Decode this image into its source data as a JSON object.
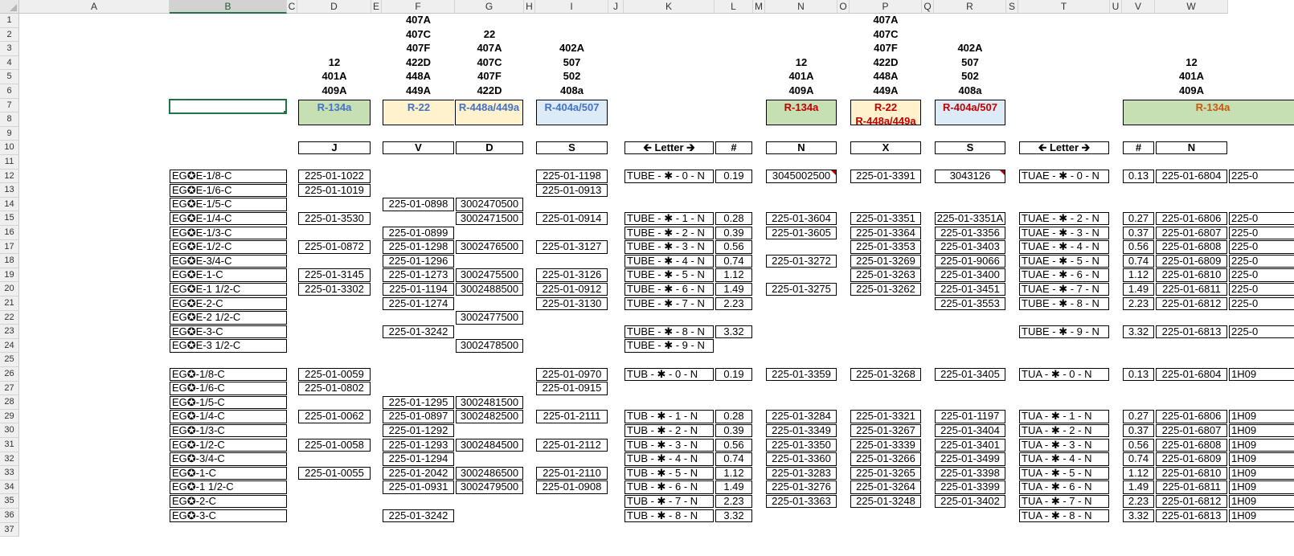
{
  "columns": [
    "A",
    "B",
    "C",
    "D",
    "E",
    "F",
    "G",
    "H",
    "I",
    "J",
    "K",
    "L",
    "M",
    "N",
    "O",
    "P",
    "Q",
    "R",
    "S",
    "T",
    "U",
    "V",
    "W"
  ],
  "rows": [
    "1",
    "2",
    "3",
    "4",
    "5",
    "6",
    "7",
    "8",
    "9",
    "10",
    "11",
    "12",
    "13",
    "14",
    "15",
    "16",
    "17",
    "18",
    "19",
    "20",
    "21",
    "22",
    "23",
    "24",
    "25",
    "26",
    "27",
    "28",
    "29",
    "30",
    "31",
    "32",
    "33",
    "34",
    "35",
    "36",
    "37"
  ],
  "selected_column": "B",
  "head": {
    "D": [
      "12",
      "401A",
      "409A"
    ],
    "F": [
      "407A",
      "407C",
      "407F",
      "422D",
      "448A",
      "449A"
    ],
    "G": [
      "22",
      "407A",
      "407C",
      "407F",
      "422D"
    ],
    "I": [
      "402A",
      "507",
      "502",
      "408a"
    ],
    "N": [
      "12",
      "401A",
      "409A"
    ],
    "P": [
      "407A",
      "407C",
      "407F",
      "422D",
      "448A",
      "449A"
    ],
    "R": [
      "402A",
      "507",
      "502",
      "408a"
    ],
    "W": [
      "12",
      "401A",
      "409A"
    ]
  },
  "refrigerants": {
    "D": "R-134a",
    "F": "R-22",
    "G": "R-448a/449a",
    "I": "R-404a/507",
    "N": "R-134a",
    "P1": "R-22",
    "P2": "R-448a/449a",
    "R": "R-404a/507",
    "VW": "R-134a"
  },
  "keys": {
    "D": "J",
    "F": "V",
    "G": "D",
    "I": "S",
    "K": "🡰 Letter 🡲",
    "L": "#",
    "N": "N",
    "P": "X",
    "R": "S",
    "T": "🡰 Letter 🡲",
    "V": "#",
    "W": "N"
  },
  "colors": {
    "green": "#c6e0b4",
    "yellow": "#fff2cc",
    "blue": "#ddebf7",
    "blue_text": "#4472c4",
    "red_text": "#c00000",
    "orange_text": "#c65911",
    "excel_green": "#217346"
  },
  "B": {
    "12": "EG✪E-1/8-C",
    "13": "EG✪E-1/6-C",
    "14": "EG✪E-1/5-C",
    "15": "EG✪E-1/4-C",
    "16": "EG✪E-1/3-C",
    "17": "EG✪E-1/2-C",
    "18": "EG✪E-3/4-C",
    "19": "EG✪E-1-C",
    "20": "EG✪E-1 1/2-C",
    "21": "EG✪E-2-C",
    "22": "EG✪E-2 1/2-C",
    "23": "EG✪E-3-C",
    "24": "EG✪E-3 1/2-C",
    "26": "EG✪-1/8-C",
    "27": "EG✪-1/6-C",
    "28": "EG✪-1/5-C",
    "29": "EG✪-1/4-C",
    "30": "EG✪-1/3-C",
    "31": "EG✪-1/2-C",
    "32": "EG✪-3/4-C",
    "33": "EG✪-1-C",
    "34": "EG✪-1 1/2-C",
    "35": "EG✪-2-C",
    "36": "EG✪-3-C"
  },
  "D": {
    "12": "225-01-1022",
    "13": "225-01-1019",
    "15": "225-01-3530",
    "17": "225-01-0872",
    "19": "225-01-3145",
    "20": "225-01-3302",
    "26": "225-01-0059",
    "27": "225-01-0802",
    "29": "225-01-0062",
    "31": "225-01-0058",
    "33": "225-01-0055"
  },
  "F": {
    "14": "225-01-0898",
    "16": "225-01-0899",
    "17": "225-01-1298",
    "18": "225-01-1296",
    "19": "225-01-1273",
    "20": "225-01-1194",
    "21": "225-01-1274",
    "23": "225-01-3242",
    "28": "225-01-1295",
    "29": "225-01-0897",
    "30": "225-01-1292",
    "31": "225-01-1293",
    "32": "225-01-1294",
    "33": "225-01-2042",
    "34": "225-01-0931",
    "36": "225-01-3242"
  },
  "G": {
    "14": "3002470500",
    "15": "3002471500",
    "17": "3002476500",
    "19": "3002475500",
    "20": "3002488500",
    "22": "3002477500",
    "24": "3002478500",
    "28": "3002481500",
    "29": "3002482500",
    "31": "3002484500",
    "33": "3002486500",
    "34": "3002479500"
  },
  "I": {
    "12": "225-01-1198",
    "13": "225-01-0913",
    "15": "225-01-0914",
    "17": "225-01-3127",
    "19": "225-01-3126",
    "20": "225-01-0912",
    "21": "225-01-3130",
    "26": "225-01-0970",
    "27": "225-01-0915",
    "29": "225-01-2111",
    "31": "225-01-2112",
    "33": "225-01-2110",
    "34": "225-01-0908"
  },
  "K": {
    "12": "TUBE - ✱ - 0 - N",
    "15": "TUBE - ✱ - 1 - N",
    "16": "TUBE - ✱ - 2 - N",
    "17": "TUBE - ✱ - 3 - N",
    "18": "TUBE - ✱ - 4 - N",
    "19": "TUBE - ✱ - 5 - N",
    "20": "TUBE - ✱ - 6 - N",
    "21": "TUBE - ✱ - 7 - N",
    "23": "TUBE - ✱ - 8 - N",
    "24": "TUBE - ✱ - 9 - N",
    "26": "TUB  - ✱ - 0 - N",
    "29": "TUB  - ✱ - 1 - N",
    "30": "TUB  - ✱ - 2 - N",
    "31": "TUB  - ✱ - 3 - N",
    "32": "TUB  - ✱ - 4 - N",
    "33": "TUB  - ✱ - 5 - N",
    "34": "TUB  - ✱ - 6 - N",
    "35": "TUB  - ✱ - 7 - N",
    "36": "TUB  - ✱ - 8 - N"
  },
  "L": {
    "12": "0.19",
    "15": "0.28",
    "16": "0.39",
    "17": "0.56",
    "18": "0.74",
    "19": "1.12",
    "20": "1.49",
    "21": "2.23",
    "23": "3.32",
    "26": "0.19",
    "29": "0.28",
    "30": "0.39",
    "31": "0.56",
    "32": "0.74",
    "33": "1.12",
    "34": "1.49",
    "35": "2.23",
    "36": "3.32"
  },
  "N": {
    "12": "3045002500",
    "15": "225-01-3604",
    "16": "225-01-3605",
    "18": "225-01-3272",
    "20": "225-01-3275",
    "26": "225-01-3359",
    "29": "225-01-3284",
    "30": "225-01-3349",
    "31": "225-01-3350",
    "32": "225-01-3360",
    "33": "225-01-3283",
    "34": "225-01-3276",
    "35": "225-01-3363"
  },
  "P": {
    "12": "225-01-3391",
    "15": "225-01-3351",
    "16": "225-01-3364",
    "17": "225-01-3353",
    "18": "225-01-3269",
    "19": "225-01-3263",
    "20": "225-01-3262",
    "26": "225-01-3268",
    "29": "225-01-3321",
    "30": "225-01-3267",
    "31": "225-01-3339",
    "32": "225-01-3266",
    "33": "225-01-3265",
    "34": "225-01-3264",
    "35": "225-01-3248"
  },
  "R": {
    "12": "3043126",
    "15": "225-01-3351A",
    "16": "225-01-3356",
    "17": "225-01-3403",
    "18": "225-01-9066",
    "19": "225-01-3400",
    "20": "225-01-3451",
    "21": "225-01-3553",
    "26": "225-01-3405",
    "29": "225-01-1197",
    "30": "225-01-3404",
    "31": "225-01-3401",
    "32": "225-01-3499",
    "33": "225-01-3398",
    "34": "225-01-3399",
    "35": "225-01-3402"
  },
  "T": {
    "12": "TUAE  - ✱ - 0 - N",
    "15": "TUAE  - ✱ - 2 - N",
    "16": "TUAE  - ✱ - 3 - N",
    "17": "TUAE  - ✱ - 4 - N",
    "18": "TUAE  - ✱ - 5 - N",
    "19": "TUAE  - ✱ - 6 - N",
    "20": "TUAE  - ✱ - 7 - N",
    "21": "TUBE - ✱ - 8 - N",
    "23": "TUBE - ✱ - 9 - N",
    "26": "TUA  - ✱ - 0 - N",
    "29": "TUA  - ✱ - 1 - N",
    "30": "TUA  - ✱ - 2 - N",
    "31": "TUA  - ✱ - 3 - N",
    "32": "TUA  - ✱ - 4 - N",
    "33": "TUA  - ✱ - 5 - N",
    "34": "TUA  - ✱ - 6 - N",
    "35": "TUA  - ✱ - 7 - N",
    "36": "TUA - ✱ - 8 - N"
  },
  "V": {
    "12": "0.13",
    "15": "0.27",
    "16": "0.37",
    "17": "0.56",
    "18": "0.74",
    "19": "1.12",
    "20": "1.49",
    "21": "2.23",
    "23": "3.32",
    "26": "0.13",
    "29": "0.27",
    "30": "0.37",
    "31": "0.56",
    "32": "0.74",
    "33": "1.12",
    "34": "1.49",
    "35": "2.23",
    "36": "3.32"
  },
  "W": {
    "12": "225-01-6804",
    "15": "225-01-6806",
    "16": "225-01-6807",
    "17": "225-01-6808",
    "18": "225-01-6809",
    "19": "225-01-6810",
    "20": "225-01-6811",
    "21": "225-01-6812",
    "23": "225-01-6813",
    "26": "225-01-6804",
    "29": "225-01-6806",
    "30": "225-01-6807",
    "31": "225-01-6808",
    "32": "225-01-6809",
    "33": "225-01-6810",
    "34": "225-01-6811",
    "35": "225-01-6812",
    "36": "225-01-6813"
  },
  "X": {
    "12": "225-0",
    "15": "225-0",
    "16": "225-0",
    "17": "225-0",
    "18": "225-0",
    "19": "225-0",
    "20": "225-0",
    "21": "225-0",
    "23": "225-0",
    "26": "1H09",
    "29": "1H09",
    "30": "1H09",
    "31": "1H09",
    "32": "1H09",
    "33": "1H09",
    "34": "1H09",
    "35": "1H09",
    "36": "1H09"
  }
}
